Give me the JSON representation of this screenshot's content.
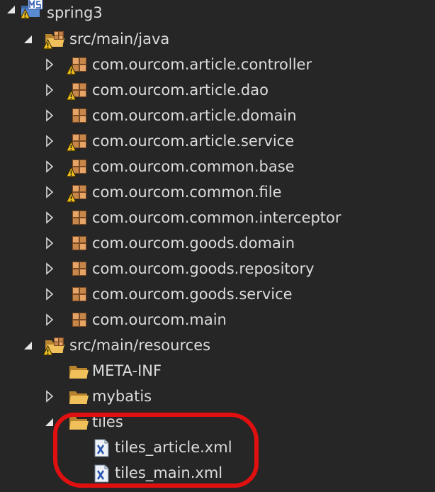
{
  "tree": {
    "project": {
      "label": "spring3",
      "icon": "maven-project-icon"
    },
    "src_main_java": {
      "label": "src/main/java",
      "icon": "source-folder-icon"
    },
    "packages": [
      {
        "label": "com.ourcom.article.controller",
        "warning": true
      },
      {
        "label": "com.ourcom.article.dao",
        "warning": true
      },
      {
        "label": "com.ourcom.article.domain",
        "warning": false
      },
      {
        "label": "com.ourcom.article.service",
        "warning": true
      },
      {
        "label": "com.ourcom.common.base",
        "warning": true
      },
      {
        "label": "com.ourcom.common.file",
        "warning": true
      },
      {
        "label": "com.ourcom.common.interceptor",
        "warning": false
      },
      {
        "label": "com.ourcom.goods.domain",
        "warning": false
      },
      {
        "label": "com.ourcom.goods.repository",
        "warning": false
      },
      {
        "label": "com.ourcom.goods.service",
        "warning": false
      },
      {
        "label": "com.ourcom.main",
        "warning": false
      }
    ],
    "src_main_resources": {
      "label": "src/main/resources",
      "icon": "source-folder-icon"
    },
    "folders": {
      "meta_inf": "META-INF",
      "mybatis": "mybatis",
      "tiles": "tiles"
    },
    "files": [
      {
        "label": "tiles_article.xml",
        "icon": "xml-file-icon"
      },
      {
        "label": "tiles_main.xml",
        "icon": "xml-file-icon"
      }
    ]
  },
  "colors": {
    "background": "#262626",
    "text": "#dcdcdc",
    "highlight_annotation": "#e01010",
    "package_icon": "#c8874a",
    "folder_icon": "#e8b04a",
    "warning_icon": "#f2c21b"
  }
}
